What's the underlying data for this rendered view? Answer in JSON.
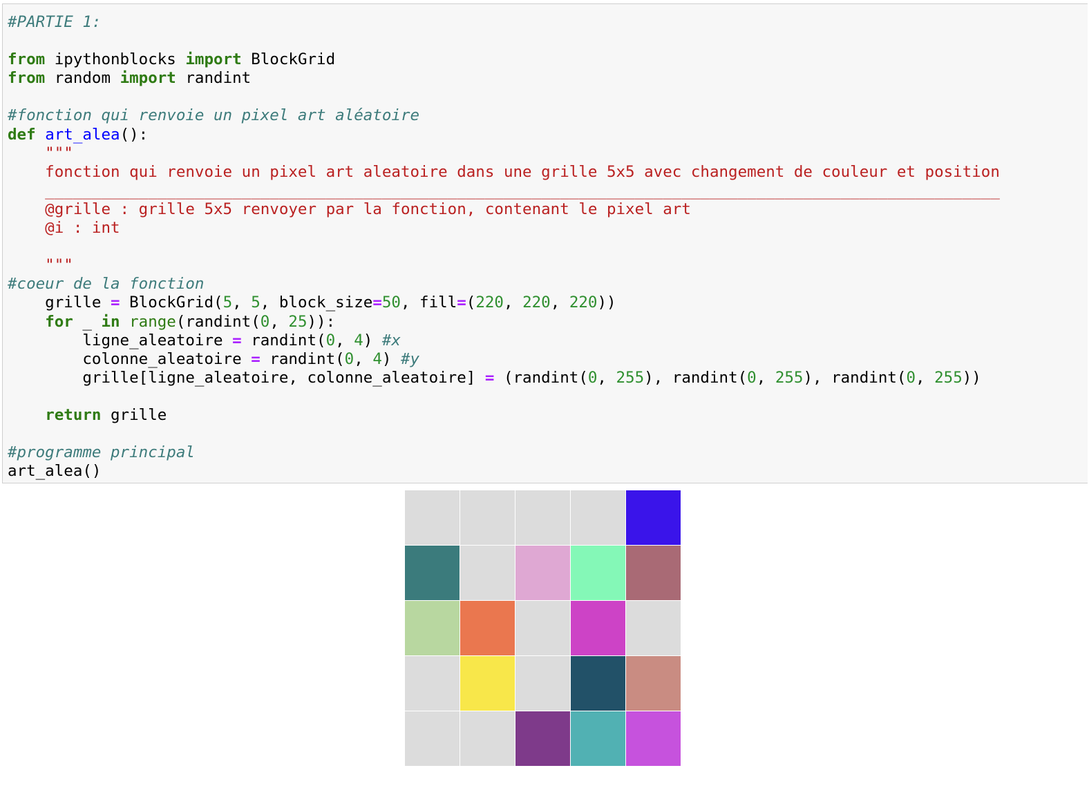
{
  "code_cell": {
    "lines": [
      [
        {
          "t": "#PARTIE 1:",
          "c": "cm"
        }
      ],
      [],
      [
        {
          "t": "from",
          "c": "kw"
        },
        {
          "t": " ipythonblocks ",
          "c": ""
        },
        {
          "t": "import",
          "c": "kw"
        },
        {
          "t": " BlockGrid",
          "c": ""
        }
      ],
      [
        {
          "t": "from",
          "c": "kw"
        },
        {
          "t": " random ",
          "c": ""
        },
        {
          "t": "import",
          "c": "kw"
        },
        {
          "t": " randint",
          "c": ""
        }
      ],
      [],
      [
        {
          "t": "#fonction qui renvoie un pixel art aléatoire",
          "c": "cm"
        }
      ],
      [
        {
          "t": "def",
          "c": "kw"
        },
        {
          "t": " ",
          "c": ""
        },
        {
          "t": "art_alea",
          "c": "fn"
        },
        {
          "t": "():",
          "c": ""
        }
      ],
      [
        {
          "t": "    \"\"\"",
          "c": "st"
        }
      ],
      [
        {
          "t": "    fonction qui renvoie un pixel art aleatoire dans une grille 5x5 avec changement de couleur et position",
          "c": "st"
        }
      ],
      [
        {
          "t": "    ______________________________________________________________________________________________________",
          "c": "st"
        }
      ],
      [
        {
          "t": "    @grille : grille 5x5 renvoyer par la fonction, contenant le pixel art",
          "c": "st"
        }
      ],
      [
        {
          "t": "    @i : int",
          "c": "st"
        }
      ],
      [],
      [
        {
          "t": "    \"\"\"",
          "c": "st"
        }
      ],
      [
        {
          "t": "#coeur de la fonction",
          "c": "cm"
        }
      ],
      [
        {
          "t": "    grille ",
          "c": ""
        },
        {
          "t": "=",
          "c": "op"
        },
        {
          "t": " BlockGrid(",
          "c": ""
        },
        {
          "t": "5",
          "c": "nu"
        },
        {
          "t": ", ",
          "c": ""
        },
        {
          "t": "5",
          "c": "nu"
        },
        {
          "t": ", block_size",
          "c": ""
        },
        {
          "t": "=",
          "c": "op"
        },
        {
          "t": "50",
          "c": "nu"
        },
        {
          "t": ", fill",
          "c": ""
        },
        {
          "t": "=",
          "c": "op"
        },
        {
          "t": "(",
          "c": ""
        },
        {
          "t": "220",
          "c": "nu"
        },
        {
          "t": ", ",
          "c": ""
        },
        {
          "t": "220",
          "c": "nu"
        },
        {
          "t": ", ",
          "c": ""
        },
        {
          "t": "220",
          "c": "nu"
        },
        {
          "t": "))",
          "c": ""
        }
      ],
      [
        {
          "t": "    ",
          "c": ""
        },
        {
          "t": "for",
          "c": "kw"
        },
        {
          "t": " _ ",
          "c": ""
        },
        {
          "t": "in",
          "c": "kw"
        },
        {
          "t": " ",
          "c": ""
        },
        {
          "t": "range",
          "c": "bi"
        },
        {
          "t": "(randint(",
          "c": ""
        },
        {
          "t": "0",
          "c": "nu"
        },
        {
          "t": ", ",
          "c": ""
        },
        {
          "t": "25",
          "c": "nu"
        },
        {
          "t": ")):",
          "c": ""
        }
      ],
      [
        {
          "t": "        ligne_aleatoire ",
          "c": ""
        },
        {
          "t": "=",
          "c": "op"
        },
        {
          "t": " randint(",
          "c": ""
        },
        {
          "t": "0",
          "c": "nu"
        },
        {
          "t": ", ",
          "c": ""
        },
        {
          "t": "4",
          "c": "nu"
        },
        {
          "t": ") ",
          "c": ""
        },
        {
          "t": "#x",
          "c": "cm"
        }
      ],
      [
        {
          "t": "        colonne_aleatoire ",
          "c": ""
        },
        {
          "t": "=",
          "c": "op"
        },
        {
          "t": " randint(",
          "c": ""
        },
        {
          "t": "0",
          "c": "nu"
        },
        {
          "t": ", ",
          "c": ""
        },
        {
          "t": "4",
          "c": "nu"
        },
        {
          "t": ") ",
          "c": ""
        },
        {
          "t": "#y",
          "c": "cm"
        }
      ],
      [
        {
          "t": "        grille[ligne_aleatoire, colonne_aleatoire] ",
          "c": ""
        },
        {
          "t": "=",
          "c": "op"
        },
        {
          "t": " (randint(",
          "c": ""
        },
        {
          "t": "0",
          "c": "nu"
        },
        {
          "t": ", ",
          "c": ""
        },
        {
          "t": "255",
          "c": "nu"
        },
        {
          "t": "), randint(",
          "c": ""
        },
        {
          "t": "0",
          "c": "nu"
        },
        {
          "t": ", ",
          "c": ""
        },
        {
          "t": "255",
          "c": "nu"
        },
        {
          "t": "), randint(",
          "c": ""
        },
        {
          "t": "0",
          "c": "nu"
        },
        {
          "t": ", ",
          "c": ""
        },
        {
          "t": "255",
          "c": "nu"
        },
        {
          "t": "))",
          "c": ""
        }
      ],
      [],
      [
        {
          "t": "    ",
          "c": ""
        },
        {
          "t": "return",
          "c": "kw"
        },
        {
          "t": " grille",
          "c": ""
        }
      ],
      [],
      [
        {
          "t": "#programme principal",
          "c": "cm"
        }
      ],
      [
        {
          "t": "art_alea()",
          "c": ""
        }
      ]
    ]
  },
  "output_grid": {
    "rows": [
      [
        "#dcdcdc",
        "#dcdcdc",
        "#dcdcdc",
        "#dcdcdc",
        "#3a14ea"
      ],
      [
        "#3b7b7c",
        "#dcdcdc",
        "#dfa8d3",
        "#84f8b7",
        "#a96a75"
      ],
      [
        "#b8d7a0",
        "#ea774f",
        "#dcdcdc",
        "#cd43c6",
        "#dcdcdc"
      ],
      [
        "#dcdcdc",
        "#f8e74a",
        "#dcdcdc",
        "#225168",
        "#c98c82"
      ],
      [
        "#dcdcdc",
        "#dcdcdc",
        "#7e3a8a",
        "#51b1b3",
        "#c652dd"
      ]
    ]
  }
}
